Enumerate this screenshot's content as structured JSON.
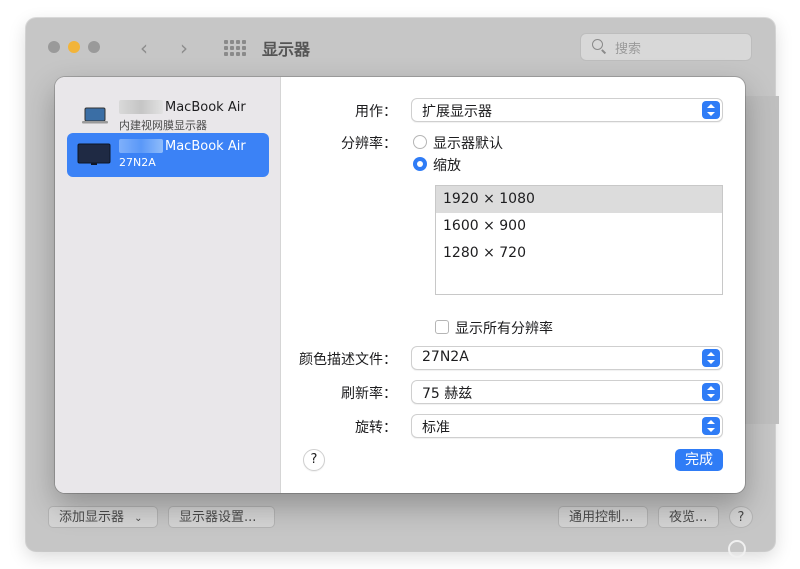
{
  "window": {
    "title": "显示器",
    "search_placeholder": "搜索",
    "buttons": {
      "add_display": "添加显示器",
      "display_settings": "显示器设置...",
      "universal_control": "通用控制...",
      "night_shift": "夜览...",
      "help": "?"
    }
  },
  "sheet": {
    "displays": [
      {
        "name": "MacBook Air",
        "subtitle": "内建视网膜显示器",
        "icon": "laptop-icon",
        "selected": false
      },
      {
        "name": "MacBook Air",
        "subtitle": "27N2A",
        "icon": "monitor-icon",
        "selected": true
      }
    ],
    "use_as_label": "用作：",
    "use_as_value": "扩展显示器",
    "resolution_label": "分辨率：",
    "resolution_default": "显示器默认",
    "resolution_scaled": "缩放",
    "resolutions": [
      "1920 × 1080",
      "1600 × 900",
      "1280 × 720"
    ],
    "selected_resolution": "1920 × 1080",
    "show_all_label": "显示所有分辨率",
    "color_profile_label": "颜色描述文件：",
    "color_profile_value": "27N2A",
    "refresh_label": "刷新率：",
    "refresh_value": "75 赫兹",
    "rotation_label": "旋转：",
    "rotation_value": "标准",
    "help": "?",
    "done": "完成"
  },
  "colors": {
    "accent": "#2f7cf6",
    "sidebar": "#e9e7ea"
  }
}
